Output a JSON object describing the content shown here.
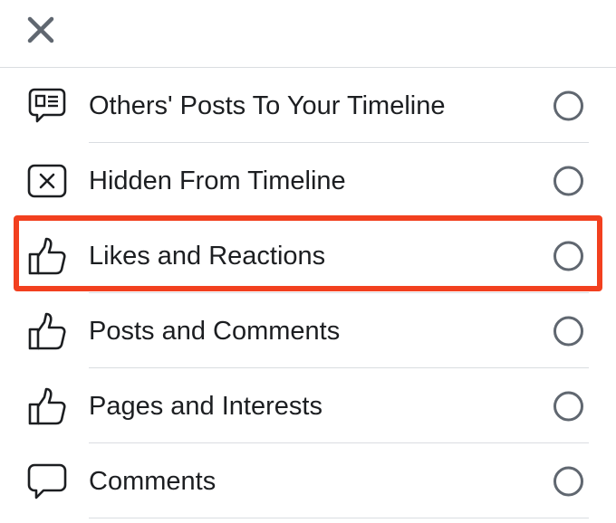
{
  "header": {
    "close_icon": "close-icon"
  },
  "items": [
    {
      "label": "Others' Posts To Your Timeline",
      "icon": "timeline-post-icon",
      "selected": false
    },
    {
      "label": "Hidden From Timeline",
      "icon": "hidden-box-icon",
      "selected": false
    },
    {
      "label": "Likes and Reactions",
      "icon": "thumbs-up-icon",
      "selected": false,
      "highlighted": true
    },
    {
      "label": "Posts and Comments",
      "icon": "thumbs-up-icon",
      "selected": false
    },
    {
      "label": "Pages and Interests",
      "icon": "thumbs-up-icon",
      "selected": false
    },
    {
      "label": "Comments",
      "icon": "comment-bubble-icon",
      "selected": false
    }
  ],
  "colors": {
    "highlight": "#f2401f",
    "icon": "#1c1e21",
    "radio_border": "#606770",
    "divider": "#dadde1"
  }
}
